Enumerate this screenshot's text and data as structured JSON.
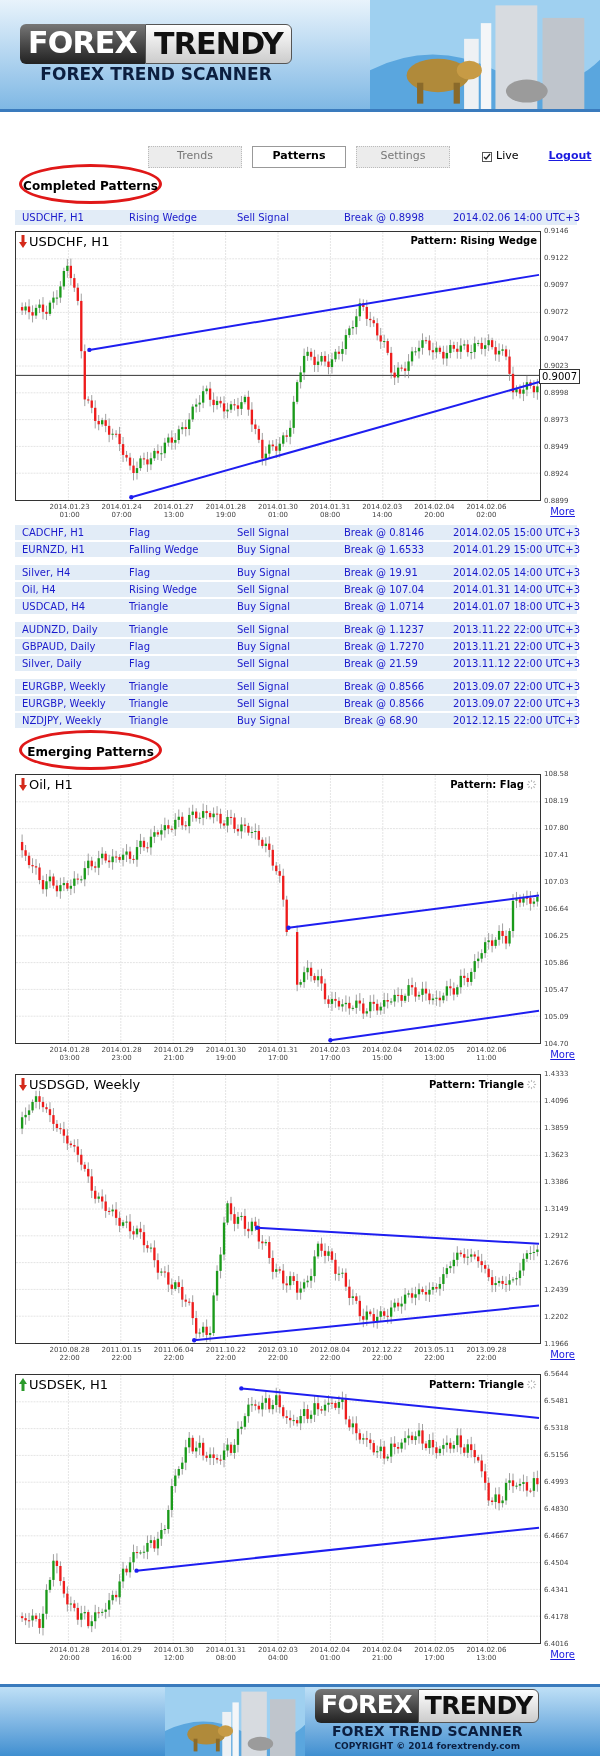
{
  "header": {
    "logo_left": "FOREX",
    "logo_right": "TRENDY",
    "tagline": "FOREX TREND SCANNER"
  },
  "nav": {
    "tabs": [
      {
        "label": "Trends",
        "selected": false
      },
      {
        "label": "Patterns",
        "selected": true
      },
      {
        "label": "Settings",
        "selected": false
      }
    ],
    "live": {
      "label": "Live",
      "checked": true
    },
    "logout": "Logout"
  },
  "completed": {
    "title": "Completed Patterns",
    "top_row": {
      "symbol": "USDCHF, H1",
      "pattern": "Rising Wedge",
      "signal": "Sell Signal",
      "break": "Break @ 0.8998",
      "time": "2014.02.06 14:00 UTC+3"
    },
    "chart": {
      "symbol": "USDCHF, H1",
      "rising": false,
      "pattern_label": "Pattern: Rising Wedge",
      "loading": false,
      "price_tag": "0.9007",
      "y_labels": [
        "0.9146",
        "0.9122",
        "0.9097",
        "0.9072",
        "0.9047",
        "0.9023",
        "0.8998",
        "0.8973",
        "0.8949",
        "0.8924",
        "0.8899"
      ],
      "x_labels": [
        [
          "2014.01.23",
          "01:00"
        ],
        [
          "2014.01.24",
          "07:00"
        ],
        [
          "2014.01.27",
          "13:00"
        ],
        [
          "2014.01.28",
          "19:00"
        ],
        [
          "2014.01.30",
          "01:00"
        ],
        [
          "2014.01.31",
          "08:00"
        ],
        [
          "2014.02.03",
          "14:00"
        ],
        [
          "2014.02.04",
          "20:00"
        ],
        [
          "2014.02.06",
          "02:00"
        ]
      ],
      "more": "More"
    },
    "groups": [
      [
        {
          "symbol": "CADCHF, H1",
          "pattern": "Flag",
          "signal": "Sell Signal",
          "break": "Break @ 0.8146",
          "time": "2014.02.05 15:00 UTC+3"
        },
        {
          "symbol": "EURNZD, H1",
          "pattern": "Falling Wedge",
          "signal": "Buy Signal",
          "break": "Break @ 1.6533",
          "time": "2014.01.29 15:00 UTC+3"
        }
      ],
      [
        {
          "symbol": "Silver, H4",
          "pattern": "Flag",
          "signal": "Buy Signal",
          "break": "Break @ 19.91",
          "time": "2014.02.05 14:00 UTC+3"
        },
        {
          "symbol": "Oil, H4",
          "pattern": "Rising Wedge",
          "signal": "Sell Signal",
          "break": "Break @ 107.04",
          "time": "2014.01.31 14:00 UTC+3"
        },
        {
          "symbol": "USDCAD, H4",
          "pattern": "Triangle",
          "signal": "Buy Signal",
          "break": "Break @ 1.0714",
          "time": "2014.01.07 18:00 UTC+3"
        }
      ],
      [
        {
          "symbol": "AUDNZD, Daily",
          "pattern": "Triangle",
          "signal": "Sell Signal",
          "break": "Break @ 1.1237",
          "time": "2013.11.22 22:00 UTC+3"
        },
        {
          "symbol": "GBPAUD, Daily",
          "pattern": "Flag",
          "signal": "Buy Signal",
          "break": "Break @ 1.7270",
          "time": "2013.11.21 22:00 UTC+3"
        },
        {
          "symbol": "Silver, Daily",
          "pattern": "Flag",
          "signal": "Sell Signal",
          "break": "Break @ 21.59",
          "time": "2013.11.12 22:00 UTC+3"
        }
      ],
      [
        {
          "symbol": "EURGBP, Weekly",
          "pattern": "Triangle",
          "signal": "Sell Signal",
          "break": "Break @ 0.8566",
          "time": "2013.09.07 22:00 UTC+3"
        },
        {
          "symbol": "EURGBP, Weekly",
          "pattern": "Triangle",
          "signal": "Sell Signal",
          "break": "Break @ 0.8566",
          "time": "2013.09.07 22:00 UTC+3"
        },
        {
          "symbol": "NZDJPY, Weekly",
          "pattern": "Triangle",
          "signal": "Buy Signal",
          "break": "Break @ 68.90",
          "time": "2012.12.15 22:00 UTC+3"
        }
      ]
    ]
  },
  "emerging": {
    "title": "Emerging Patterns",
    "charts": [
      {
        "symbol": "Oil, H1",
        "rising": false,
        "pattern_label": "Pattern: Flag",
        "loading": true,
        "y_labels": [
          "108.58",
          "108.19",
          "107.80",
          "107.41",
          "107.03",
          "106.64",
          "106.25",
          "105.86",
          "105.47",
          "105.09",
          "104.70"
        ],
        "x_labels": [
          [
            "2014.01.28",
            "03:00"
          ],
          [
            "2014.01.28",
            "23:00"
          ],
          [
            "2014.01.29",
            "21:00"
          ],
          [
            "2014.01.30",
            "19:00"
          ],
          [
            "2014.01.31",
            "17:00"
          ],
          [
            "2014.02.03",
            "17:00"
          ],
          [
            "2014.02.04",
            "15:00"
          ],
          [
            "2014.02.05",
            "13:00"
          ],
          [
            "2014.02.06",
            "11:00"
          ]
        ],
        "more": "More"
      },
      {
        "symbol": "USDSGD, Weekly",
        "rising": false,
        "pattern_label": "Pattern: Triangle",
        "loading": true,
        "y_labels": [
          "1.4333",
          "1.4096",
          "1.3859",
          "1.3623",
          "1.3386",
          "1.3149",
          "1.2912",
          "1.2676",
          "1.2439",
          "1.2202",
          "1.1966"
        ],
        "x_labels": [
          [
            "2010.08.28",
            "22:00"
          ],
          [
            "2011.01.15",
            "22:00"
          ],
          [
            "2011.06.04",
            "22:00"
          ],
          [
            "2011.10.22",
            "22:00"
          ],
          [
            "2012.03.10",
            "22:00"
          ],
          [
            "2012.08.04",
            "22:00"
          ],
          [
            "2012.12.22",
            "22:00"
          ],
          [
            "2013.05.11",
            "22:00"
          ],
          [
            "2013.09.28",
            "22:00"
          ]
        ],
        "more": "More"
      },
      {
        "symbol": "USDSEK, H1",
        "rising": true,
        "pattern_label": "Pattern: Triangle",
        "loading": true,
        "y_labels": [
          "6.5644",
          "6.5481",
          "6.5318",
          "6.5156",
          "6.4993",
          "6.4830",
          "6.4667",
          "6.4504",
          "6.4341",
          "6.4178",
          "6.4016"
        ],
        "x_labels": [
          [
            "2014.01.28",
            "20:00"
          ],
          [
            "2014.01.29",
            "16:00"
          ],
          [
            "2014.01.30",
            "12:00"
          ],
          [
            "2014.01.31",
            "08:00"
          ],
          [
            "2014.02.03",
            "04:00"
          ],
          [
            "2014.02.04",
            "01:00"
          ],
          [
            "2014.02.04",
            "21:00"
          ],
          [
            "2014.02.05",
            "17:00"
          ],
          [
            "2014.02.06",
            "13:00"
          ]
        ],
        "more": "More"
      }
    ]
  },
  "footer": {
    "logo_left": "FOREX",
    "logo_right": "TRENDY",
    "tagline": "FOREX TREND SCANNER",
    "copyright": "COPYRIGHT © 2014 forextrendy.com"
  }
}
